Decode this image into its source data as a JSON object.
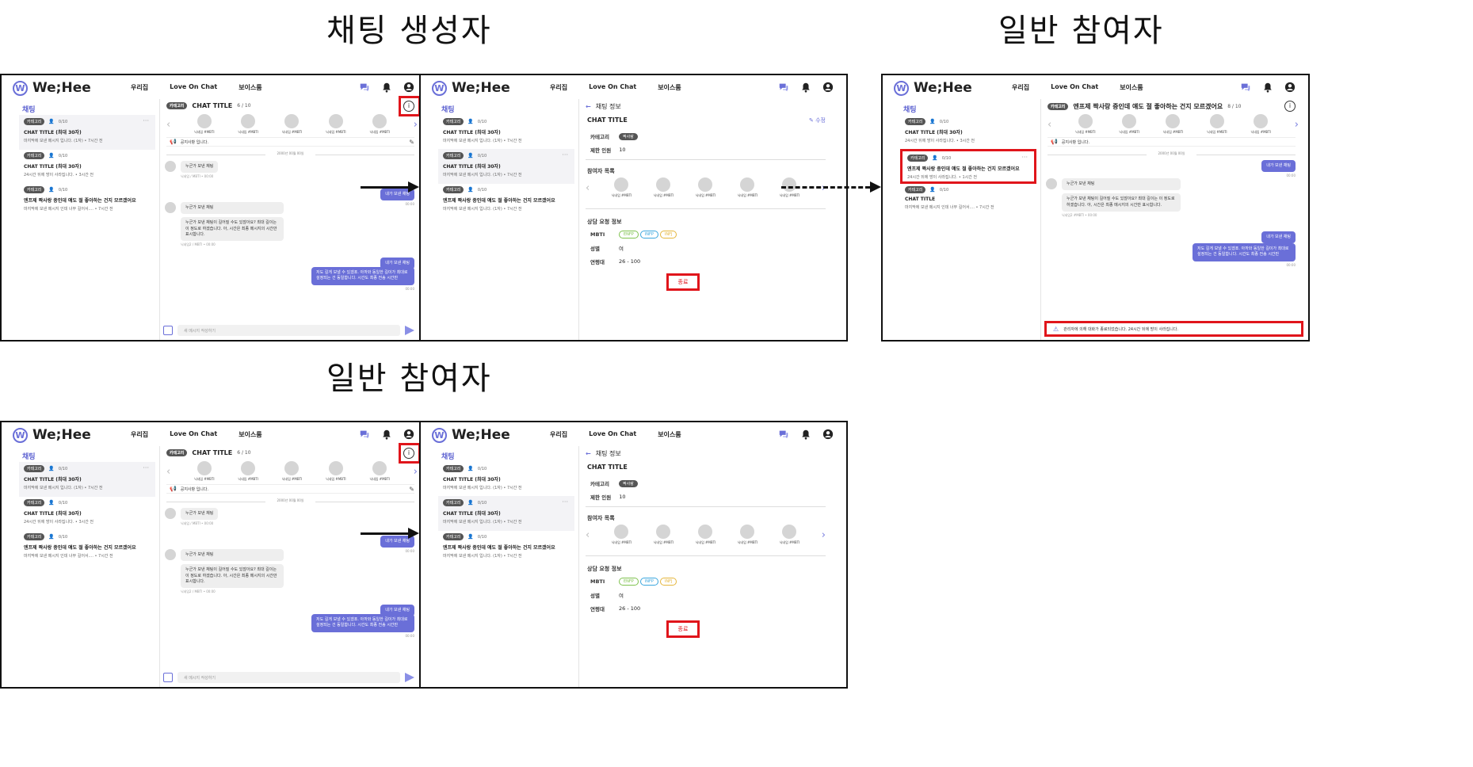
{
  "headings": {
    "creator": "채팅 생성자",
    "participant_top": "일반 참여자",
    "participant_bottom": "일반 참여자"
  },
  "app": {
    "brand": "We;Hee",
    "logo_mark": "W",
    "menu": [
      "우리집",
      "Love On Chat",
      "보이스룸"
    ],
    "sidebar_title": "채팅",
    "accent": "#6a6fd8",
    "highlight": "#e0151b"
  },
  "rooms": [
    {
      "category": "카테고리",
      "count": "0/10",
      "title": "CHAT TITLE (최대 30자)",
      "sub": "마지막에 보낸 메시지 입니다. (1자)  •  7시간 전"
    },
    {
      "category": "카테고리",
      "count": "0/10",
      "title": "CHAT TITLE (최대 30자)",
      "sub": "24시간 뒤에 방이 사라집니다.  •  3시간 전"
    },
    {
      "category": "카테고리",
      "count": "0/10",
      "title": "엔프제 짝사랑 중인데 얘도 절 좋아하는 건지 모르겠어요",
      "sub": "마지막에 보낸 메시지 인데 너무 길어서....  •  7시간 전"
    }
  ],
  "rooms_info": [
    {
      "category": "카테고리",
      "count": "0/10",
      "title": "CHAT TITLE (최대 30자)",
      "sub": "마지막에 보낸 메시지 입니다. (1자)  •  7시간 전"
    },
    {
      "category": "카테고리",
      "count": "0/10",
      "title": "CHAT TITLE (최대 30자)",
      "sub": "마지막에 보낸 메시지 입니다. (1자)  •  7시간 전"
    },
    {
      "category": "카테고리",
      "count": "0/10",
      "title": "엔프제 짝사랑 중인데 얘도 절 좋아하는 건지 모르겠어요",
      "sub": "마지막에 보낸 메시지 입니다. (1자)  •  7시간 전"
    }
  ],
  "rooms_ended": [
    {
      "category": "카테고리",
      "count": "0/10",
      "title": "CHAT TITLE (최대 30자)",
      "sub": "24시간 뒤에 방이 사라집니다.  •  3시간 전"
    },
    {
      "category": "카테고리",
      "count": "0/10",
      "title": "엔프제 짝사랑 중인데 얘도 절 좋아하는 건지 모르겠어요",
      "sub": "24시간 뒤에 방이 사라집니다.  •  1시간 전"
    },
    {
      "category": "카테고리",
      "count": "0/10",
      "title": "CHAT TITLE",
      "sub": "마지막에 보낸 메시지 인데 너무 길어서....  •  7시간 전"
    }
  ],
  "chat": {
    "category": "카테고리",
    "title": "CHAT TITLE",
    "count": "6 / 10",
    "participant_label": "닉네임 #MBTI",
    "notice": "공지사항 입니다.",
    "date": "2000년 00월 00일",
    "msg1": "누군가 보낸 채팅",
    "msg1_meta": "닉네임 / MBTI  •  00:00",
    "msg2": "누군가 보낸 채팅이 길어질 수도 있잖아요? 최대 길이는 이 정도로 하겠습니다. 아, 시간은 최종 메시지의 시간만 표시합니다.",
    "msg2_meta": "닉네임2 / MBTI  •  00:00",
    "mine1": "내가 보낸 채팅",
    "mine2": "내가 보낸 채팅",
    "mine3": "저도 길게 보낼 수 있겠죠. 아까와 동일한 길이가 최대로 설정되는 건 동일합니다. 시간도 최종 전송 시간만",
    "time": "00:00",
    "placeholder": "새 메시지 작성하기"
  },
  "ended_chat": {
    "title": "엔프제 짝사랑 중인데 얘도 절 좋아하는 건지 모르겠어요",
    "count": "8 / 10",
    "end_notice": "관리자에 의해 대화가 종료되었습니다. 24시간 뒤에 방이 사라집니다.",
    "msg2_meta": "닉네임2 #MBTI  •  00:00"
  },
  "info": {
    "back": "채팅 정보",
    "title": "CHAT TITLE",
    "edit": "수정",
    "category_label": "카테고리",
    "category_value": "짝사랑",
    "limit_label": "제한 인원",
    "limit_value": "10",
    "participants_label": "참여자 목록",
    "request_label": "상담 요청 정보",
    "mbti_label": "MBTI",
    "mbti": [
      "ENFP",
      "INFP",
      "INFJ"
    ],
    "gender_label": "성별",
    "gender_value": "여",
    "age_label": "연령대",
    "age_value": "26 - 100",
    "end_button": "종료"
  }
}
